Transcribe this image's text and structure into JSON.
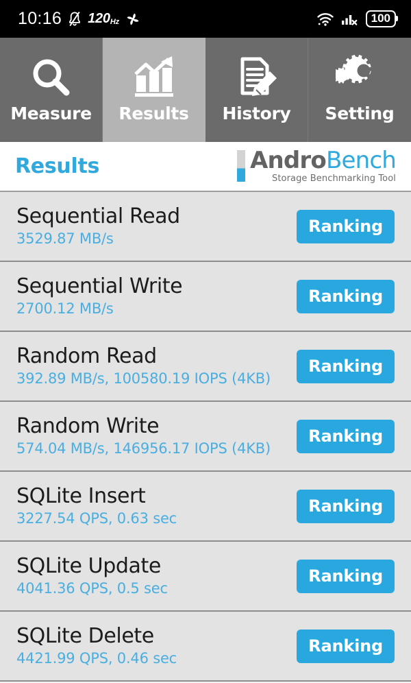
{
  "statusbar": {
    "clock": "10:16",
    "mute_icon": "bell-muted-icon",
    "refresh_rate": "120",
    "refresh_rate_unit": "Hz",
    "fan_icon": "fan-icon",
    "wifi_icon": "wifi-icon",
    "signal_icon": "cellular-signal-off-icon",
    "battery": "100"
  },
  "tabs": [
    {
      "label": "Measure",
      "icon": "magnifier-icon",
      "active": false
    },
    {
      "label": "Results",
      "icon": "bar-chart-trend-icon",
      "active": true
    },
    {
      "label": "History",
      "icon": "document-pencil-icon",
      "active": false
    },
    {
      "label": "Setting",
      "icon": "gears-icon",
      "active": false
    }
  ],
  "header": {
    "title": "Results",
    "logo_primary": "Andro",
    "logo_secondary": "Bench",
    "logo_tagline": "Storage Benchmarking Tool"
  },
  "results": [
    {
      "name": "Sequential Read",
      "value": "3529.87 MB/s",
      "button": "Ranking"
    },
    {
      "name": "Sequential Write",
      "value": "2700.12 MB/s",
      "button": "Ranking"
    },
    {
      "name": "Random Read",
      "value": "392.89 MB/s, 100580.19 IOPS (4KB)",
      "button": "Ranking"
    },
    {
      "name": "Random Write",
      "value": "574.04 MB/s, 146956.17 IOPS (4KB)",
      "button": "Ranking"
    },
    {
      "name": "SQLite Insert",
      "value": "3227.54 QPS, 0.63 sec",
      "button": "Ranking"
    },
    {
      "name": "SQLite Update",
      "value": "4041.36 QPS, 0.5 sec",
      "button": "Ranking"
    },
    {
      "name": "SQLite Delete",
      "value": "4421.99 QPS, 0.46 sec",
      "button": "Ranking"
    }
  ],
  "colors": {
    "accent_blue": "#29a8e0",
    "value_blue": "#4aaee0",
    "tab_inactive": "#6b6b6b",
    "tab_active": "#b4b4b4",
    "list_bg": "#e3e3e3"
  }
}
